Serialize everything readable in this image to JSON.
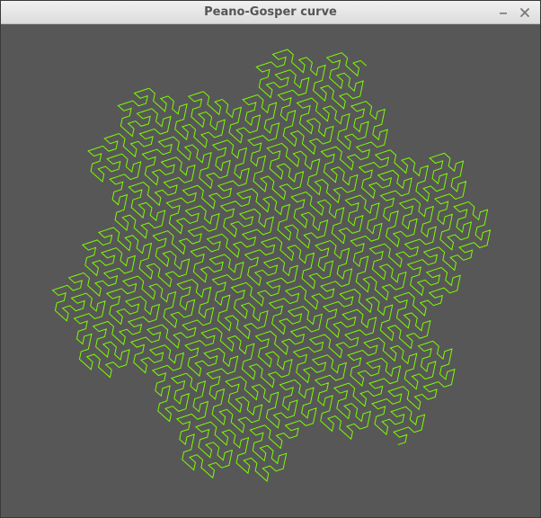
{
  "window": {
    "title": "Peano-Gosper curve",
    "controls": [
      {
        "icon": "minimize-icon"
      },
      {
        "icon": "close-icon"
      }
    ]
  },
  "canvas": {
    "background": "#575757",
    "curve": {
      "name": "Peano-Gosper curve",
      "order": 4,
      "stroke_color": "#7CFC00"
    }
  }
}
